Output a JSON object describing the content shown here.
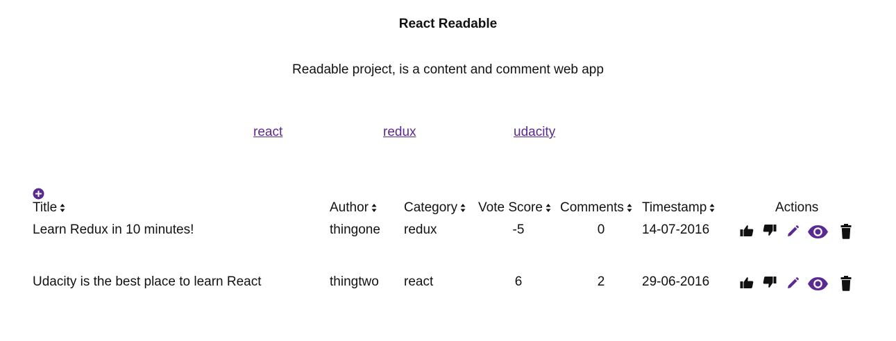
{
  "header": {
    "title": "React Readable",
    "subtitle": "Readable project, is a content and comment web app"
  },
  "categories": [
    {
      "label": "react"
    },
    {
      "label": "redux"
    },
    {
      "label": "udacity"
    }
  ],
  "table": {
    "add_icon": "plus-circle-icon",
    "columns": [
      {
        "label": "Title",
        "sortable": true
      },
      {
        "label": "Author",
        "sortable": true
      },
      {
        "label": "Category",
        "sortable": true
      },
      {
        "label": "Vote Score",
        "sortable": true
      },
      {
        "label": "Comments",
        "sortable": true
      },
      {
        "label": "Timestamp",
        "sortable": true
      },
      {
        "label": "Actions",
        "sortable": false
      }
    ],
    "rows": [
      {
        "title": "Learn Redux in 10 minutes!",
        "author": "thingone",
        "category": "redux",
        "vote_score": "-5",
        "comments": "0",
        "timestamp": "14-07-2016"
      },
      {
        "title": "Udacity is the best place to learn React",
        "author": "thingtwo",
        "category": "react",
        "vote_score": "6",
        "comments": "2",
        "timestamp": "29-06-2016"
      }
    ],
    "actions": [
      "thumbs-up-icon",
      "thumbs-down-icon",
      "pencil-icon",
      "eye-icon",
      "trash-icon"
    ]
  },
  "colors": {
    "accent": "#5a2a91",
    "text": "#111111",
    "background": "#ffffff"
  }
}
